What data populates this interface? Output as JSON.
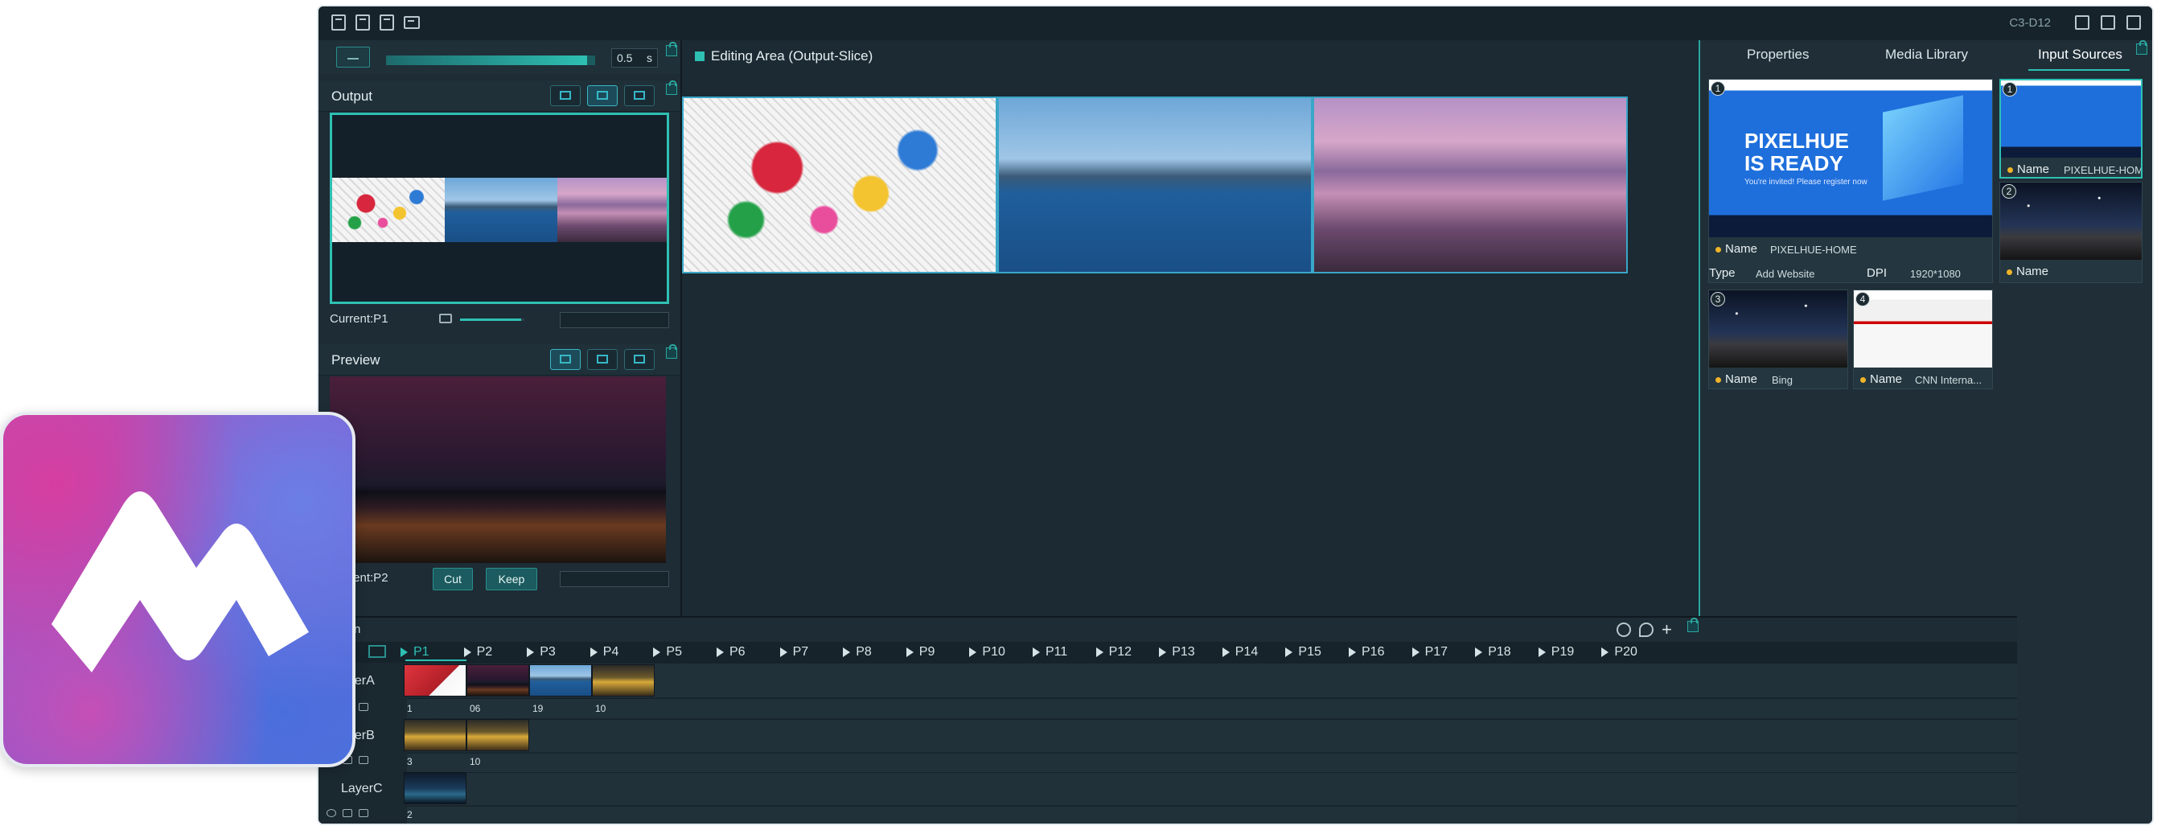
{
  "app_icon": {
    "name": "app-logo"
  },
  "titlebar": {
    "device": "C3-D12"
  },
  "take": {
    "duration": "0.5",
    "unit": "s"
  },
  "output": {
    "title": "Output",
    "current": "Current:P1"
  },
  "preview": {
    "title": "Preview",
    "current": "Current:P2",
    "cut_label": "Cut",
    "keep_label": "Keep"
  },
  "editing": {
    "title": "Editing Area (Output-Slice)"
  },
  "right_panel": {
    "tabs": [
      "Properties",
      "Media Library",
      "Input Sources"
    ],
    "sources": [
      {
        "num": "1",
        "name_key": "Name",
        "name": "PIXELHUE-HOME",
        "type_key": "Type",
        "type": "Add Website",
        "dpi_key": "DPI",
        "dpi": "1920*1080",
        "banner": "PIXELHUE IS READY",
        "subtitle": "You're invited! Please register now"
      },
      {
        "num": "1",
        "name_key": "Name",
        "name": "PIXELHUE-HOME"
      },
      {
        "num": "2",
        "name_key": "Name",
        "name": ""
      },
      {
        "num": "3",
        "name_key": "Name",
        "name": "Bing"
      },
      {
        "num": "4",
        "name_key": "Name",
        "name": "CNN Interna..."
      }
    ]
  },
  "timeline": {
    "title": "n",
    "pages": [
      "P1",
      "P2",
      "P3",
      "P4",
      "P5",
      "P6",
      "P7",
      "P8",
      "P9",
      "P10",
      "P11",
      "P12",
      "P13",
      "P14",
      "P15",
      "P16",
      "P17",
      "P18",
      "P19",
      "P20"
    ],
    "active_page": "P1",
    "layers": [
      {
        "name": "LayerA",
        "display": "ayerA",
        "clips": [
          "1",
          "06",
          "19",
          "10"
        ]
      },
      {
        "name": "LayerB",
        "display": "ayerB",
        "clips": [
          "3",
          "10"
        ]
      },
      {
        "name": "LayerC",
        "display": "LayerC",
        "clips": [
          "2"
        ]
      }
    ]
  },
  "colors": {
    "accent": "#2ec0b3",
    "background": "#1d2c35",
    "badge": "#f0b429"
  }
}
